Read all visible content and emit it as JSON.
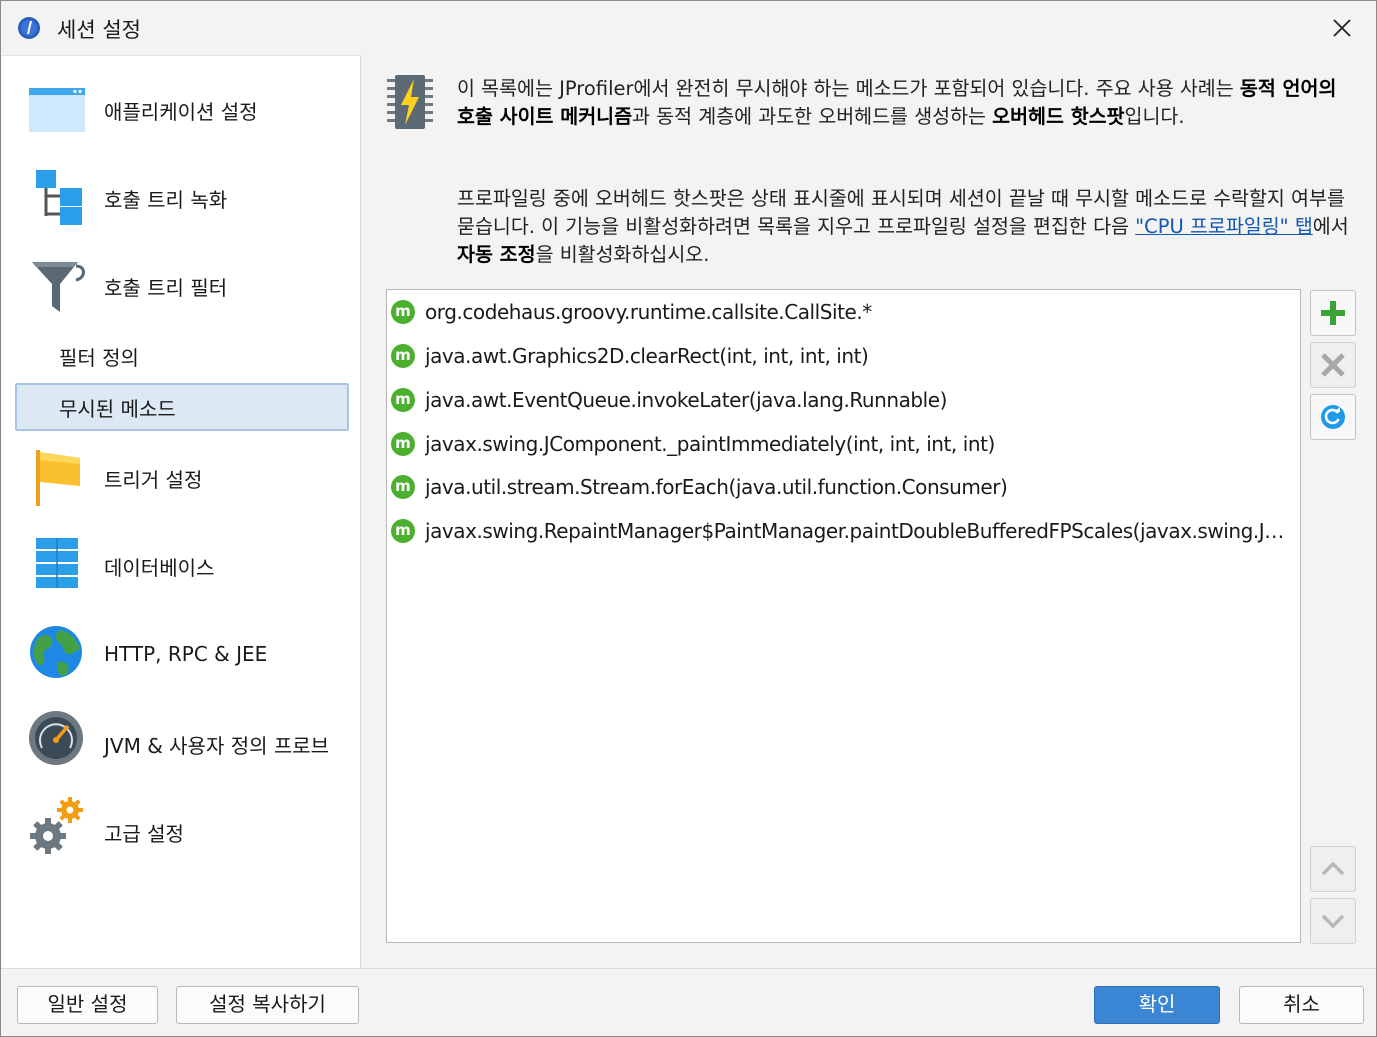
{
  "window": {
    "title": "세션 설정",
    "close_glyph": "✕"
  },
  "sidebar": {
    "items": [
      {
        "label": "애플리케이션 설정",
        "icon": "app-window-icon"
      },
      {
        "label": "호출 트리 녹화",
        "icon": "call-tree-icon"
      },
      {
        "label": "호출 트리 필터",
        "icon": "funnel-icon"
      },
      {
        "label": "필터 정의",
        "sub": true
      },
      {
        "label": "무시된 메소드",
        "sub": true,
        "selected": true
      },
      {
        "label": "트리거 설정",
        "icon": "flag-icon"
      },
      {
        "label": "데이터베이스",
        "icon": "database-icon"
      },
      {
        "label": "HTTP, RPC & JEE",
        "icon": "globe-icon"
      },
      {
        "label": "JVM & 사용자 정의 프로브",
        "icon": "gauge-icon"
      },
      {
        "label": "고급 설정",
        "icon": "gears-icon"
      }
    ]
  },
  "description": {
    "p1_a": "이 목록에는 JProfiler에서 완전히 무시해야 하는 메소드가 포함되어 있습니다. 주요 사용 사례는 ",
    "p1_b": "동적 언어의 호출 사이트 메커니즘",
    "p1_c": "과 동적 계층에 과도한 오버헤드를 생성하는 ",
    "p1_d": "오버헤드 핫스팟",
    "p1_e": "입니다.",
    "p2_a": "프로파일링 중에 오버헤드 핫스팟은 상태 표시줄에 표시되며 세션이 끝날 때 무시할 메소드로 수락할지 여부를 묻습니다. 이 기능을 비활성화하려면 목록을 지우고 프로파일링 설정을 편집한 다음 ",
    "p2_link": "\"CPU 프로파일링\" 탭",
    "p2_b": "에서 ",
    "p2_c": "자동 조정",
    "p2_d": "을 비활성화하십시오."
  },
  "methods": [
    "org.codehaus.groovy.runtime.callsite.CallSite.*",
    "java.awt.Graphics2D.clearRect(int, int, int, int)",
    "java.awt.EventQueue.invokeLater(java.lang.Runnable)",
    "javax.swing.JComponent._paintImmediately(int, int, int, int)",
    "java.util.stream.Stream.forEach(java.util.function.Consumer)",
    "javax.swing.RepaintManager$PaintManager.paintDoubleBufferedFPScales(javax.swing.JComponent, java.awt.Image, java.awt.Graphics, int, int, int, int)"
  ],
  "method_icon_letter": "m",
  "buttons": {
    "general": "일반 설정",
    "copy": "설정 복사하기",
    "ok": "확인",
    "cancel": "취소"
  },
  "colors": {
    "accent": "#3b86d4",
    "method_icon": "#4caf2f",
    "selected_bg": "#dde8f5"
  }
}
